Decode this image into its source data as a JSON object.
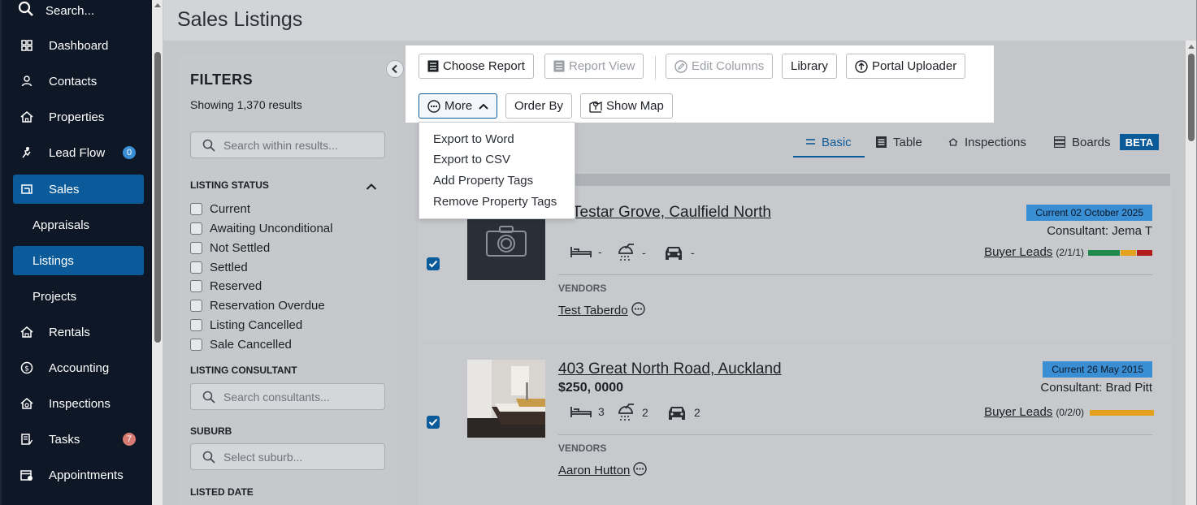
{
  "sidebar": {
    "search_label": "Search...",
    "items": [
      {
        "label": "Dashboard"
      },
      {
        "label": "Contacts"
      },
      {
        "label": "Properties"
      },
      {
        "label": "Lead Flow",
        "badge": "0"
      },
      {
        "label": "Sales"
      },
      {
        "label": "Appraisals"
      },
      {
        "label": "Listings"
      },
      {
        "label": "Projects"
      },
      {
        "label": "Rentals"
      },
      {
        "label": "Accounting"
      },
      {
        "label": "Inspections"
      },
      {
        "label": "Tasks",
        "badge": "7"
      },
      {
        "label": "Appointments"
      }
    ]
  },
  "page": {
    "title": "Sales Listings"
  },
  "filters": {
    "title": "FILTERS",
    "showing": "Showing 1,370 results",
    "search_placeholder": "Search within results...",
    "listing_status": {
      "heading": "LISTING STATUS",
      "options": [
        "Current",
        "Awaiting Unconditional",
        "Not Settled",
        "Settled",
        "Reserved",
        "Reservation Overdue",
        "Listing Cancelled",
        "Sale Cancelled"
      ]
    },
    "consultant": {
      "heading": "LISTING CONSULTANT",
      "placeholder": "Search consultants..."
    },
    "suburb": {
      "heading": "SUBURB",
      "placeholder": "Select suburb..."
    },
    "listed_date": {
      "heading": "LISTED DATE"
    }
  },
  "toolbar": {
    "choose_report": "Choose Report",
    "report_view": "Report View",
    "edit_columns": "Edit Columns",
    "library": "Library",
    "portal_uploader": "Portal Uploader",
    "more": "More",
    "order_by": "Order By",
    "show_map": "Show Map"
  },
  "more_menu": {
    "items": [
      "Export to Word",
      "Export to CSV",
      "Add Property Tags",
      "Remove Property Tags"
    ]
  },
  "view_tabs": {
    "basic": "Basic",
    "table": "Table",
    "inspections": "Inspections",
    "boards": "Boards",
    "beta": "BETA"
  },
  "listings": [
    {
      "address": "Testar Grove, Caulfield North",
      "price": "",
      "beds": "-",
      "baths": "-",
      "cars": "-",
      "status": "Current 02 October 2025",
      "consultant": "Consultant: Jema T",
      "buyer_leads_label": "Buyer Leads",
      "buyer_leads_count": "(2/1/1)",
      "vendors_heading": "VENDORS",
      "vendor": "Test Taberdo",
      "lead_bar": [
        2,
        1,
        1
      ]
    },
    {
      "address": "403 Great North Road, Auckland",
      "price": "$250, 0000",
      "beds": "3",
      "baths": "2",
      "cars": "2",
      "status": "Current 26 May 2015",
      "consultant": "Consultant: Brad Pitt",
      "buyer_leads_label": "Buyer Leads",
      "buyer_leads_count": "(0/2/0)",
      "vendors_heading": "VENDORS",
      "vendor": "Aaron Hutton",
      "lead_bar": [
        0,
        2,
        0
      ]
    }
  ],
  "colors": {
    "accent": "#0b5a99",
    "status_badge": "#3a8ed3",
    "lead_green": "#1f8a4c",
    "lead_orange": "#e3a11f",
    "lead_red": "#b31b1b"
  }
}
